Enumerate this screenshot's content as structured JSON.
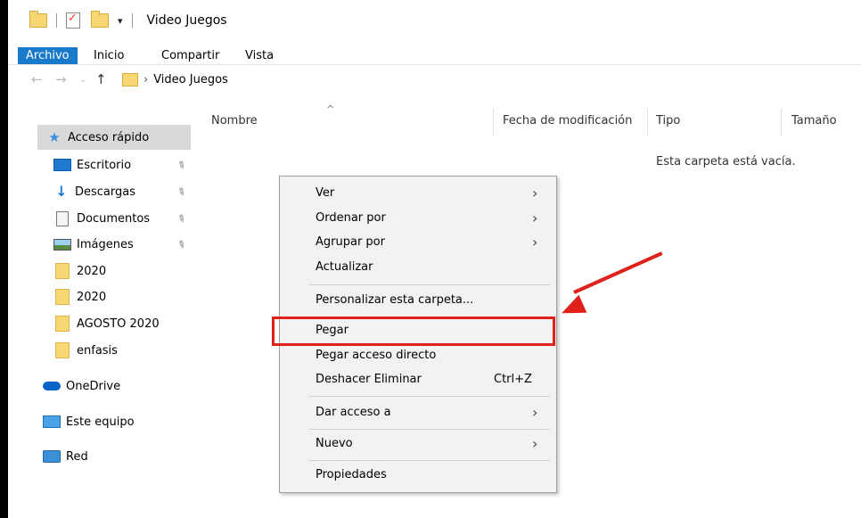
{
  "window": {
    "title": "Video Juegos"
  },
  "ribbon": {
    "tabs": [
      "Archivo",
      "Inicio",
      "Compartir",
      "Vista"
    ]
  },
  "address": {
    "crumb": "Video Juegos"
  },
  "sidebar": {
    "quick_access": "Acceso rápido",
    "items": [
      "Escritorio",
      "Descargas",
      "Documentos",
      "Imágenes",
      "2020",
      "2020",
      "AGOSTO 2020",
      "enfasis"
    ],
    "onedrive": "OneDrive",
    "this_pc": "Este equipo",
    "network": "Red"
  },
  "columns": {
    "name": "Nombre",
    "date": "Fecha de modificación",
    "type": "Tipo",
    "size": "Tamaño"
  },
  "content": {
    "empty_message": "Esta carpeta está vacía."
  },
  "context_menu": {
    "items": [
      "Ver",
      "Ordenar por",
      "Agrupar por",
      "Actualizar",
      "Personalizar esta carpeta...",
      "Pegar",
      "Pegar acceso directo",
      "Deshacer Eliminar",
      "Dar acceso a",
      "Nuevo",
      "Propiedades"
    ],
    "undo_shortcut": "Ctrl+Z"
  },
  "colors": {
    "archivo_tab": "#1979ca",
    "annotation": "#e0201b"
  }
}
